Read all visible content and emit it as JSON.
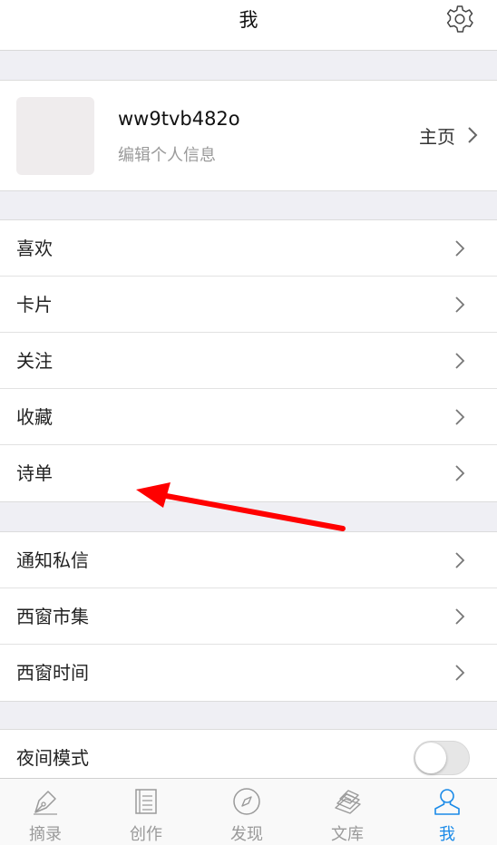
{
  "header": {
    "title": "我",
    "settings_icon": "gear-icon"
  },
  "profile": {
    "username": "ww9tvb482o",
    "edit_label": "编辑个人信息",
    "homepage_label": "主页"
  },
  "menu_group_1": {
    "items": [
      {
        "label": "喜欢"
      },
      {
        "label": "卡片"
      },
      {
        "label": "关注"
      },
      {
        "label": "收藏"
      },
      {
        "label": "诗单"
      }
    ]
  },
  "menu_group_2": {
    "items": [
      {
        "label": "通知私信"
      },
      {
        "label": "西窗市集"
      },
      {
        "label": "西窗时间"
      }
    ]
  },
  "night_mode": {
    "label": "夜间模式",
    "enabled": false
  },
  "tabbar": {
    "active_color": "#1a8ae8",
    "inactive_color": "#9a9a9a",
    "tabs": [
      {
        "label": "摘录",
        "icon": "pen-nib-icon"
      },
      {
        "label": "创作",
        "icon": "document-icon"
      },
      {
        "label": "发现",
        "icon": "compass-icon"
      },
      {
        "label": "文库",
        "icon": "books-icon"
      },
      {
        "label": "我",
        "icon": "person-icon",
        "active": true
      }
    ]
  },
  "annotation": {
    "color": "#ff0000"
  }
}
